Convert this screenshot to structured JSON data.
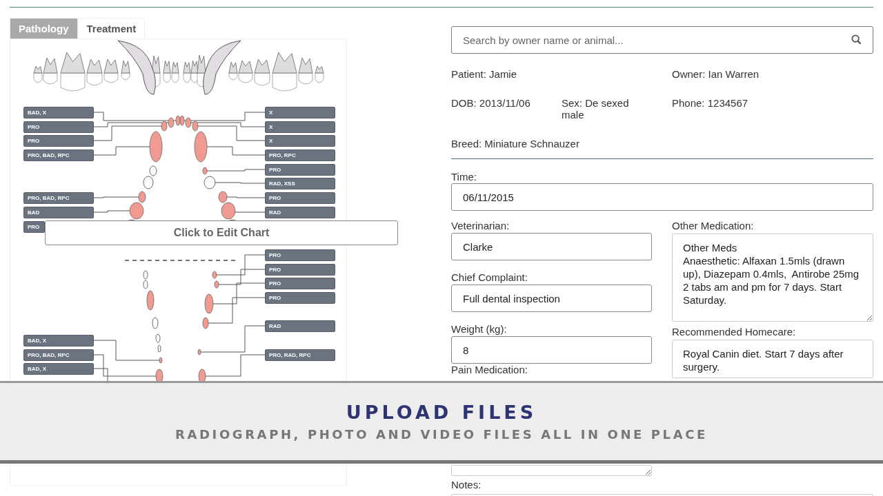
{
  "chart_tabs": [
    {
      "label": "Pathology",
      "selected": true
    },
    {
      "label": "Treatment",
      "selected": false
    }
  ],
  "dental_chart": {
    "left_labels": [
      "BAD, X",
      "PRO",
      "PRO",
      "PRO, BAD, RPC",
      "PRO, BAD, RPC",
      "BAD",
      "PRO",
      "BAD, X",
      "PRO, BAD, RPC",
      "BAD, X"
    ],
    "right_labels": [
      "X",
      "X",
      "X",
      "PRO, RPC",
      "PRO",
      "RAD, XSS",
      "PRO",
      "RAD",
      "PRO",
      "PRO",
      "PRO",
      "PRO",
      "RAD",
      "PRO, RAD, RPC"
    ],
    "edit_button": "Click to Edit Chart"
  },
  "search": {
    "placeholder": "Search by owner name or animal..."
  },
  "patient": {
    "patient": "Patient: Jamie",
    "owner": "Owner: Ian Warren",
    "dob": "DOB: 2013/11/06",
    "sex": "Sex: De sexed male",
    "phone": "Phone: 1234567",
    "breed": "Breed: Miniature Schnauzer"
  },
  "time": {
    "label": "Time:",
    "value": "06/11/2015"
  },
  "left_fields": [
    {
      "label": "Veterinarian:",
      "value": "Clarke",
      "kind": "input"
    },
    {
      "label": "Chief Complaint:",
      "value": "Full dental inspection",
      "kind": "input"
    },
    {
      "label": "Weight (kg):",
      "value": "8",
      "kind": "input"
    },
    {
      "label": "Pain Medication:",
      "kind": "textarea"
    }
  ],
  "right_fields": [
    {
      "label": "Other Medication:",
      "value": "Other Meds\nAnaesthetic: Alfaxan 1.5mls (drawn up), Diazepam 0.4mls,  Antirobe 25mg 2 tabs am and pm for 7 days. Start Saturday."
    },
    {
      "label": "Recommended Homecare:",
      "value": "Royal Canin diet. Start 7 days after surgery."
    }
  ],
  "notes": {
    "label": "Notes:"
  },
  "banner": {
    "title": "UPLOAD FILES",
    "subtitle": "RADIOGRAPH, PHOTO AND VIDEO FILES ALL IN ONE PLACE"
  }
}
